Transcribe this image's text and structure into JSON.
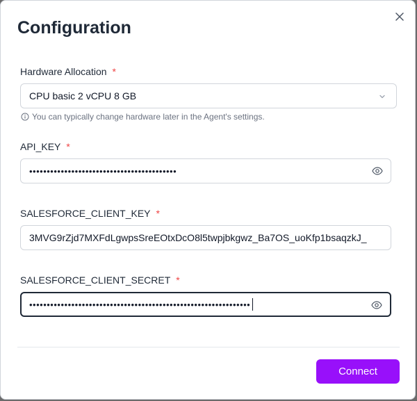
{
  "dialog": {
    "title": "Configuration",
    "close_icon": "close-icon"
  },
  "hardware": {
    "label": "Hardware Allocation",
    "required_mark": "*",
    "selected": "CPU basic 2 vCPU 8 GB",
    "hint": "You can typically change hardware later in the Agent's settings."
  },
  "fields": {
    "api_key": {
      "label": "API_KEY",
      "required_mark": "*",
      "masked_value": "••••••••••••••••••••••••••••••••••••••••••"
    },
    "sf_client_key": {
      "label": "SALESFORCE_CLIENT_KEY",
      "required_mark": "*",
      "value": "3MVG9rZjd7MXFdLgwpsSreEOtxDcO8l5twpjbkgwz_Ba7OS_uoKfp1bsaqzkJ_"
    },
    "sf_client_secret": {
      "label": "SALESFORCE_CLIENT_SECRET",
      "required_mark": "*",
      "masked_value": "•••••••••••••••••••••••••••••••••••••••••••••••••••••••••••••••"
    }
  },
  "footer": {
    "connect_label": "Connect"
  },
  "colors": {
    "primary": "#9810fa",
    "required": "#ef4444",
    "hint": "#6b7280"
  }
}
